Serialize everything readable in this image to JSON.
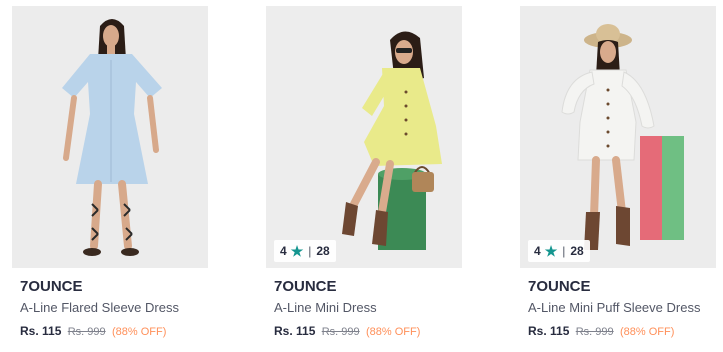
{
  "products": [
    {
      "brand": "7OUNCE",
      "name": "A-Line Flared Sleeve Dress",
      "price": "Rs. 115",
      "mrp": "Rs. 999",
      "discount": "(88% OFF)",
      "rating": null,
      "rating_count": null,
      "dress_color": "#b9d3ea",
      "backdrop": "#ececec"
    },
    {
      "brand": "7OUNCE",
      "name": "A-Line Mini Dress",
      "price": "Rs. 115",
      "mrp": "Rs. 999",
      "discount": "(88% OFF)",
      "rating": "4",
      "rating_count": "28",
      "dress_color": "#e9ea8a",
      "backdrop": "#ededed"
    },
    {
      "brand": "7OUNCE",
      "name": "A-Line Mini Puff Sleeve Dress",
      "price": "Rs. 115",
      "mrp": "Rs. 999",
      "discount": "(88% OFF)",
      "rating": "4",
      "rating_count": "28",
      "dress_color": "#f4f4f2",
      "backdrop": "#ececec"
    }
  ],
  "colors": {
    "star": "#14958f",
    "discount": "#ff905a",
    "mrp": "#7e818c"
  },
  "icons": {
    "rating": "star-icon"
  }
}
